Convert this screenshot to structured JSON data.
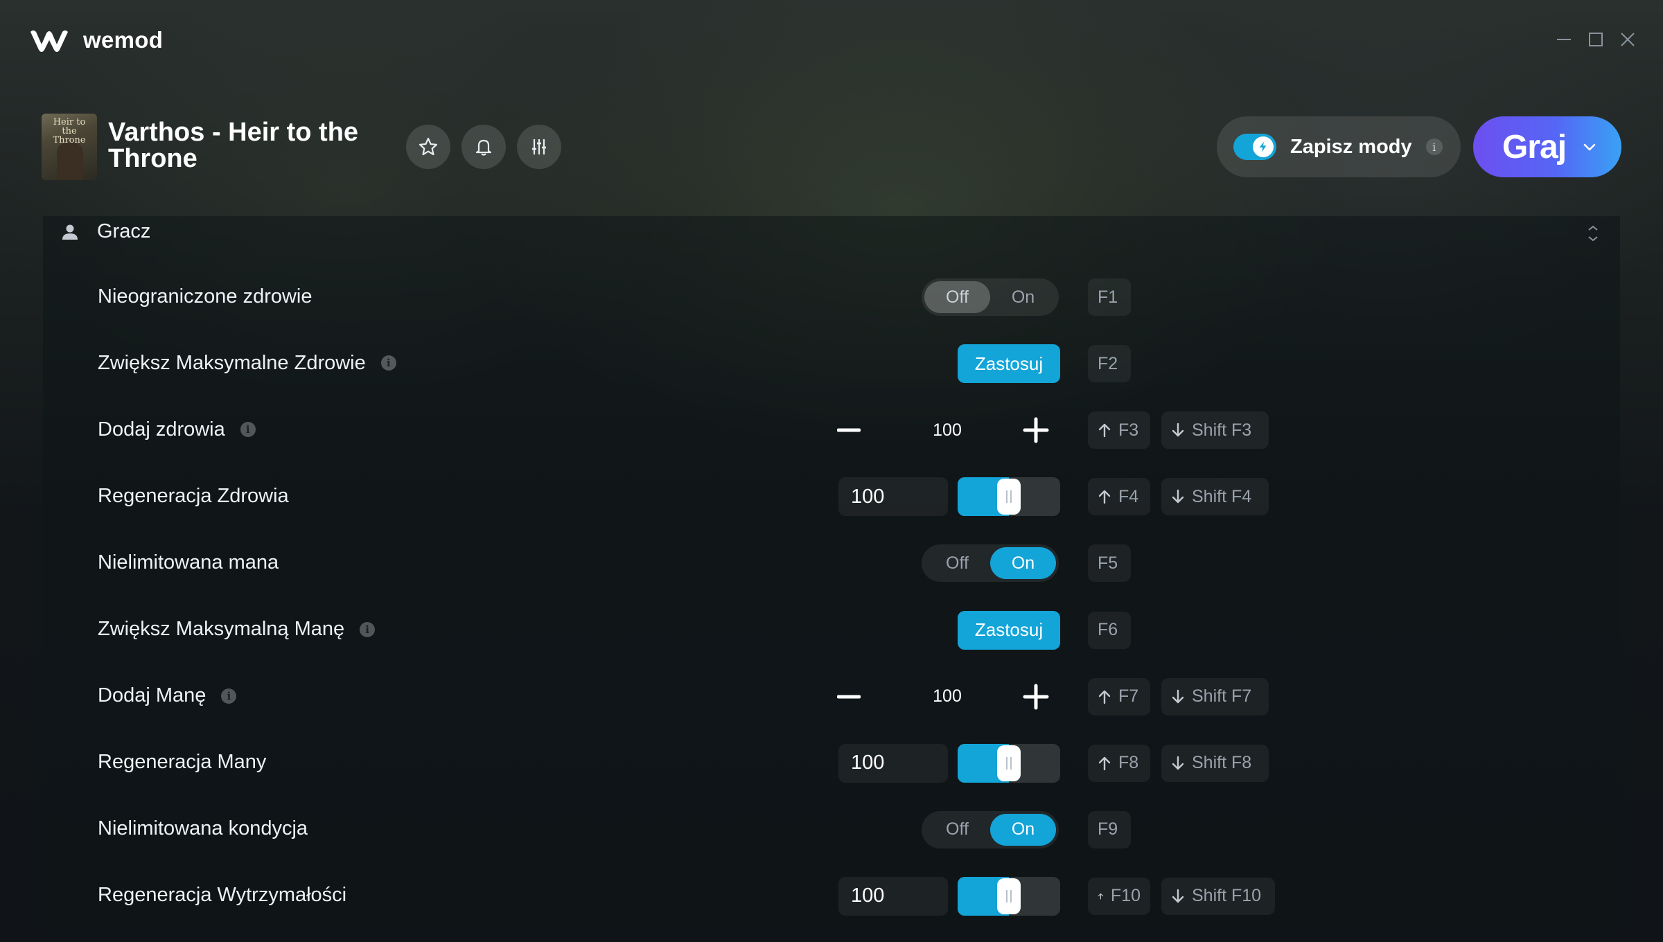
{
  "app": {
    "name": "wemod"
  },
  "game": {
    "title": "Varthos - Heir to the Throne",
    "thumb_text": "Heir to the Throne"
  },
  "header": {
    "save_mods_label": "Zapisz mody",
    "save_mods_info": "i",
    "play_label": "Graj"
  },
  "section": {
    "label": "Gracz"
  },
  "toggle_labels": {
    "off": "Off",
    "on": "On"
  },
  "apply_label": "Zastosuj",
  "mods": [
    {
      "label": "Nieograniczone zdrowie",
      "control": "toggle",
      "state": "Off",
      "hotkeys": [
        {
          "dir": "",
          "key": "F1"
        }
      ]
    },
    {
      "label": "Zwiększ Maksymalne Zdrowie",
      "info": true,
      "control": "button",
      "hotkeys": [
        {
          "dir": "",
          "key": "F2"
        }
      ]
    },
    {
      "label": "Dodaj zdrowia",
      "info": true,
      "control": "stepper",
      "value": "100",
      "hotkeys": [
        {
          "dir": "up",
          "key": "F3"
        },
        {
          "dir": "down",
          "key": "Shift F3"
        }
      ]
    },
    {
      "label": "Regeneracja Zdrowia",
      "control": "slider",
      "value": "100",
      "level": 0.5,
      "hotkeys": [
        {
          "dir": "up",
          "key": "F4"
        },
        {
          "dir": "down",
          "key": "Shift F4"
        }
      ]
    },
    {
      "label": "Nielimitowana mana",
      "control": "toggle",
      "state": "On",
      "hotkeys": [
        {
          "dir": "",
          "key": "F5"
        }
      ]
    },
    {
      "label": "Zwiększ Maksymalną Manę",
      "info": true,
      "control": "button",
      "hotkeys": [
        {
          "dir": "",
          "key": "F6"
        }
      ]
    },
    {
      "label": "Dodaj Manę",
      "info": true,
      "control": "stepper",
      "value": "100",
      "hotkeys": [
        {
          "dir": "up",
          "key": "F7"
        },
        {
          "dir": "down",
          "key": "Shift F7"
        }
      ]
    },
    {
      "label": "Regeneracja Many",
      "control": "slider",
      "value": "100",
      "level": 0.5,
      "hotkeys": [
        {
          "dir": "up",
          "key": "F8"
        },
        {
          "dir": "down",
          "key": "Shift F8"
        }
      ]
    },
    {
      "label": "Nielimitowana kondycja",
      "control": "toggle",
      "state": "On",
      "hotkeys": [
        {
          "dir": "",
          "key": "F9"
        }
      ]
    },
    {
      "label": "Regeneracja Wytrzymałości",
      "control": "slider",
      "value": "100",
      "level": 0.5,
      "hotkeys": [
        {
          "dir": "up",
          "key": "F10"
        },
        {
          "dir": "down",
          "key": "Shift F10"
        }
      ]
    }
  ],
  "colors": {
    "accent": "#13a4d8",
    "play_gradient_start": "#6d4ff0",
    "play_gradient_end": "#3aa1f5"
  },
  "icons": {
    "logo": "wemod-logo-icon",
    "favorite": "star-icon",
    "notify": "bell-icon",
    "settings": "sliders-icon",
    "section": "user-icon",
    "collapse": "collapse-icon",
    "play_menu": "chevron-down-icon",
    "save_toggle": "lightning-icon"
  }
}
